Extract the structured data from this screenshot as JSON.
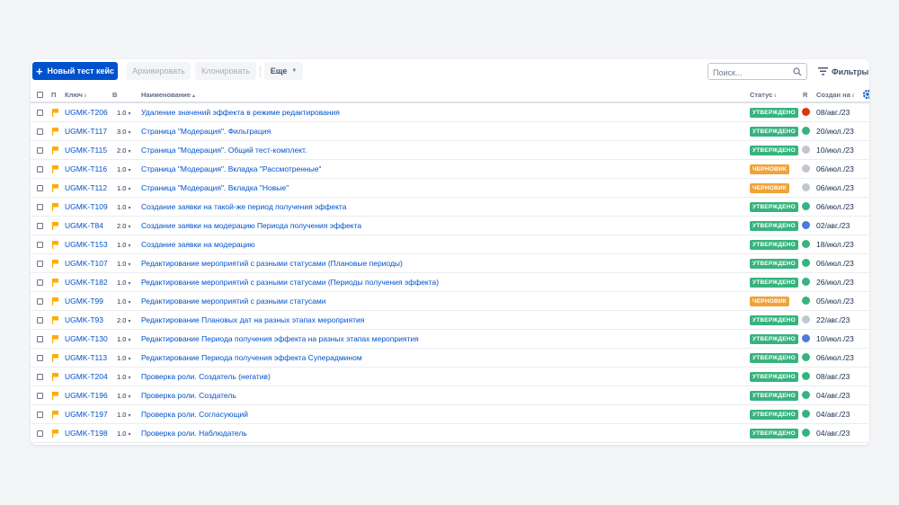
{
  "toolbar": {
    "new_test_case": "Новый тест кейс",
    "archive": "Архивировать",
    "clone": "Клонировать",
    "more": "Еще",
    "search_placeholder": "Поиск...",
    "filters": "Фильтры"
  },
  "columns": {
    "priority": "П",
    "key": "Ключ",
    "version": "В",
    "name": "Наименование",
    "status": "Статус",
    "result": "R",
    "created": "Создан на"
  },
  "colors": {
    "primary": "#0052cc",
    "approved": "#36b37e",
    "draft": "#f0a33a",
    "flag": "#ffab00",
    "dot_green": "#36b37e",
    "dot_red": "#de350b",
    "dot_gray": "#c1c7d0",
    "dot_blue": "#4c7bd9"
  },
  "rows": [
    {
      "key": "UGMK-T206",
      "version": "1.0",
      "name": "Удаление значений эффекта в режиме редактирования",
      "status": "УТВЕРЖДЕНО",
      "status_kind": "approved",
      "result": "red",
      "created": "08/авг./23"
    },
    {
      "key": "UGMK-T117",
      "version": "3.0",
      "name": "Страница \"Модерация\". Фильтрация",
      "status": "УТВЕРЖДЕНО",
      "status_kind": "approved",
      "result": "green",
      "created": "20/июл./23"
    },
    {
      "key": "UGMK-T115",
      "version": "2.0",
      "name": "Страница \"Модерация\". Общий тест-комплект.",
      "status": "УТВЕРЖДЕНО",
      "status_kind": "approved",
      "result": "gray",
      "created": "10/июл./23"
    },
    {
      "key": "UGMK-T116",
      "version": "1.0",
      "name": "Страница \"Модерация\". Вкладка \"Рассмотренные\"",
      "status": "ЧЕРНОВИК",
      "status_kind": "draft",
      "result": "gray",
      "created": "06/июл./23"
    },
    {
      "key": "UGMK-T112",
      "version": "1.0",
      "name": "Страница \"Модерация\". Вкладка \"Новые\"",
      "status": "ЧЕРНОВИК",
      "status_kind": "draft",
      "result": "gray",
      "created": "06/июл./23"
    },
    {
      "key": "UGMK-T109",
      "version": "1.0",
      "name": "Создание заявки на такой-же период получения эффекта",
      "status": "УТВЕРЖДЕНО",
      "status_kind": "approved",
      "result": "green",
      "created": "06/июл./23"
    },
    {
      "key": "UGMK-T84",
      "version": "2.0",
      "name": "Создание заявки на модерацию Периода получения эффекта",
      "status": "УТВЕРЖДЕНО",
      "status_kind": "approved",
      "result": "blue",
      "created": "02/авг./23"
    },
    {
      "key": "UGMK-T153",
      "version": "1.0",
      "name": "Создание заявки на модерацию",
      "status": "УТВЕРЖДЕНО",
      "status_kind": "approved",
      "result": "green",
      "created": "18/июл./23"
    },
    {
      "key": "UGMK-T107",
      "version": "1.0",
      "name": "Редактирование мероприятий с разными статусами (Плановые периоды)",
      "status": "УТВЕРЖДЕНО",
      "status_kind": "approved",
      "result": "green",
      "created": "06/июл./23"
    },
    {
      "key": "UGMK-T182",
      "version": "1.0",
      "name": "Редактирование мероприятий с разными статусами (Периоды получения эффекта)",
      "status": "УТВЕРЖДЕНО",
      "status_kind": "approved",
      "result": "green",
      "created": "26/июл./23"
    },
    {
      "key": "UGMK-T99",
      "version": "1.0",
      "name": "Редактирование мероприятий с разными статусами",
      "status": "ЧЕРНОВИК",
      "status_kind": "draft",
      "result": "green",
      "created": "05/июл./23"
    },
    {
      "key": "UGMK-T93",
      "version": "2.0",
      "name": "Редактирование Плановых дат на разных этапах мероприятия",
      "status": "УТВЕРЖДЕНО",
      "status_kind": "approved",
      "result": "gray",
      "created": "22/авг./23"
    },
    {
      "key": "UGMK-T130",
      "version": "1.0",
      "name": "Редактирование Периода получения эффекта на разных этапах мероприятия",
      "status": "УТВЕРЖДЕНО",
      "status_kind": "approved",
      "result": "blue",
      "created": "10/июл./23"
    },
    {
      "key": "UGMK-T113",
      "version": "1.0",
      "name": "Редактирование Периода получения эффекта Суперадмином",
      "status": "УТВЕРЖДЕНО",
      "status_kind": "approved",
      "result": "green",
      "created": "06/июл./23"
    },
    {
      "key": "UGMK-T204",
      "version": "1.0",
      "name": "Проверка роли. Создатель (негатив)",
      "status": "УТВЕРЖДЕНО",
      "status_kind": "approved",
      "result": "green",
      "created": "08/авг./23"
    },
    {
      "key": "UGMK-T196",
      "version": "1.0",
      "name": "Проверка роли. Создатель",
      "status": "УТВЕРЖДЕНО",
      "status_kind": "approved",
      "result": "green",
      "created": "04/авг./23"
    },
    {
      "key": "UGMK-T197",
      "version": "1.0",
      "name": "Проверка роли. Согласующий",
      "status": "УТВЕРЖДЕНО",
      "status_kind": "approved",
      "result": "green",
      "created": "04/авг./23"
    },
    {
      "key": "UGMK-T198",
      "version": "1.0",
      "name": "Проверка роли. Наблюдатель",
      "status": "УТВЕРЖДЕНО",
      "status_kind": "approved",
      "result": "green",
      "created": "04/авг./23"
    }
  ]
}
